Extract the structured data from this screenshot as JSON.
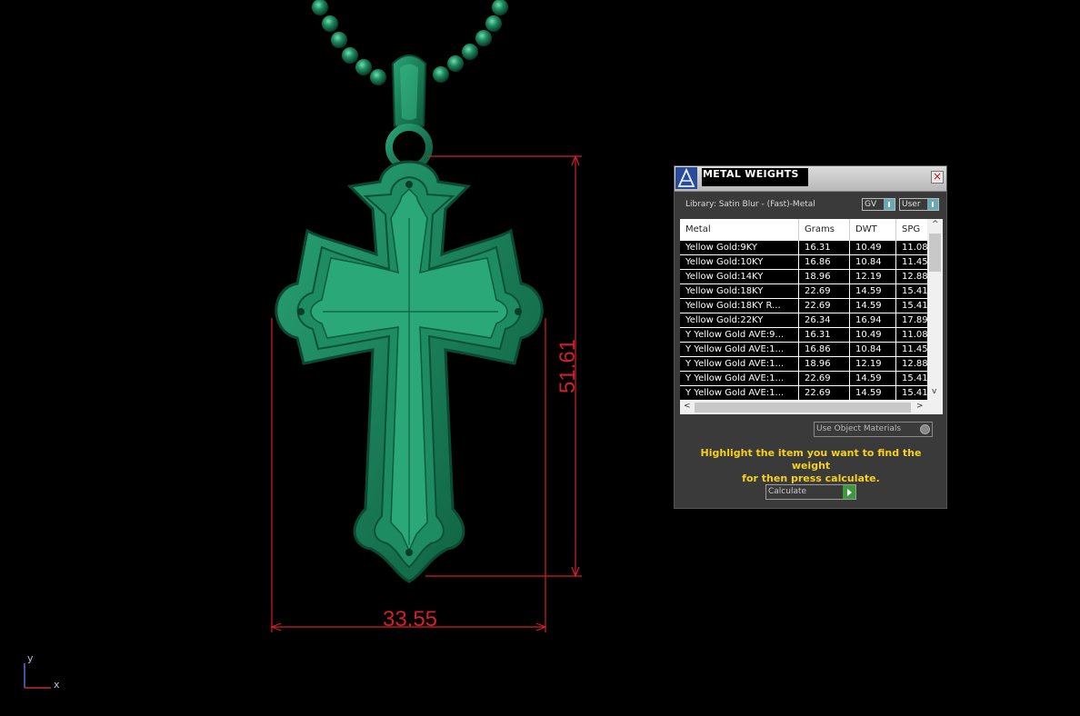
{
  "viewport": {
    "dimension_height": "51.61",
    "dimension_width": "33.55",
    "axis_y": "y",
    "axis_x": "x",
    "model_color": "#1e8a62",
    "dimension_color": "#d0202a"
  },
  "panel": {
    "title": "METAL WEIGHTS",
    "close_label": "×",
    "library_label": "Library: Satin Blur - (Fast)-Metal",
    "gv_select": "GV",
    "user_select": "User",
    "columns": [
      "Metal",
      "Grams",
      "DWT",
      "SPG"
    ],
    "rows": [
      [
        "Yellow Gold:9KY",
        "16.31",
        "10.49",
        "11.08"
      ],
      [
        "Yellow Gold:10KY",
        "16.86",
        "10.84",
        "11.45"
      ],
      [
        "Yellow Gold:14KY",
        "18.96",
        "12.19",
        "12.88"
      ],
      [
        "Yellow Gold:18KY",
        "22.69",
        "14.59",
        "15.41"
      ],
      [
        "Yellow Gold:18KY R...",
        "22.69",
        "14.59",
        "15.41"
      ],
      [
        "Yellow Gold:22KY",
        "26.34",
        "16.94",
        "17.89"
      ],
      [
        "Y Yellow Gold AVE:9...",
        "16.31",
        "10.49",
        "11.08"
      ],
      [
        "Y Yellow Gold AVE:1...",
        "16.86",
        "10.84",
        "11.45"
      ],
      [
        "Y Yellow Gold AVE:1...",
        "18.96",
        "12.19",
        "12.88"
      ],
      [
        "Y Yellow Gold AVE:1...",
        "22.69",
        "14.59",
        "15.41"
      ],
      [
        "Y Yellow Gold AVE:1...",
        "22.69",
        "14.59",
        "15.41"
      ]
    ],
    "use_object_materials": "Use Object Materials",
    "hint_line1": "Highlight the item you want to find the weight",
    "hint_line2": "for then press calculate.",
    "calculate_label": "Calculate",
    "scroll_up": "^",
    "scroll_down": "v",
    "scroll_left": "<",
    "scroll_right": ">"
  }
}
